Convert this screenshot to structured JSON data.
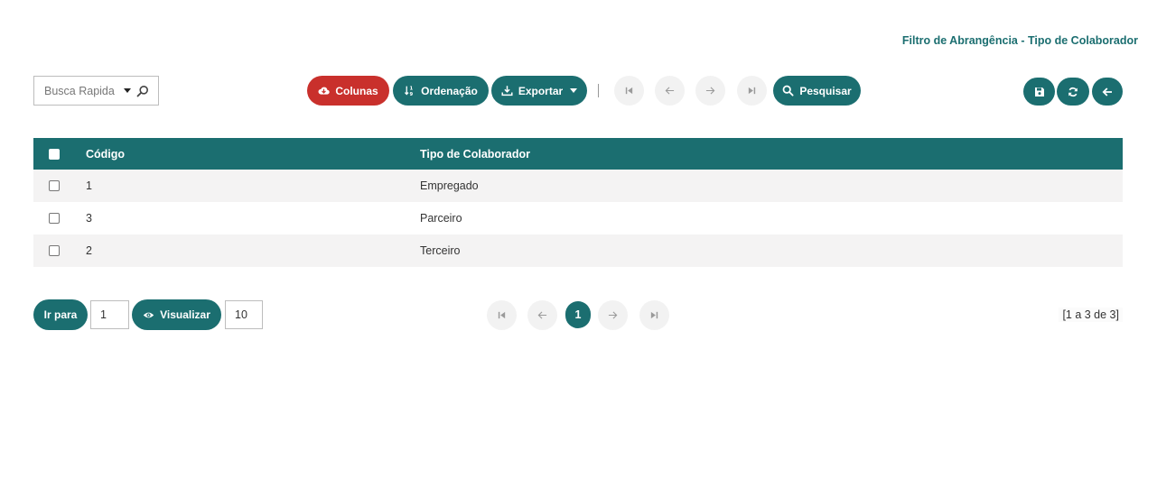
{
  "page_title": "Filtro de Abrangência - Tipo de Colaborador",
  "toolbar": {
    "search_placeholder": "Busca Rapida",
    "columns_label": "Colunas",
    "sort_label": "Ordenação",
    "export_label": "Exportar",
    "search_button_label": "Pesquisar"
  },
  "grid": {
    "headers": {
      "codigo": "Código",
      "tipo": "Tipo de Colaborador"
    },
    "rows": [
      {
        "codigo": "1",
        "tipo": "Empregado"
      },
      {
        "codigo": "3",
        "tipo": "Parceiro"
      },
      {
        "codigo": "2",
        "tipo": "Terceiro"
      }
    ]
  },
  "footer": {
    "goto_label": "Ir para",
    "goto_value": "1",
    "view_label": "Visualizar",
    "view_value": "10",
    "current_page": "1",
    "page_info": "[1 a 3 de 3]"
  },
  "colors": {
    "accent": "#1b6e70",
    "danger": "#c9302c",
    "row_stripe": "#f4f3f3"
  },
  "icons": [
    "cloud-download-icon",
    "sort-icon",
    "download-icon",
    "first-page-icon",
    "prev-page-icon",
    "next-page-icon",
    "last-page-icon",
    "search-icon",
    "save-icon",
    "refresh-icon",
    "back-arrow-icon",
    "eye-icon",
    "chevron-down-icon"
  ]
}
